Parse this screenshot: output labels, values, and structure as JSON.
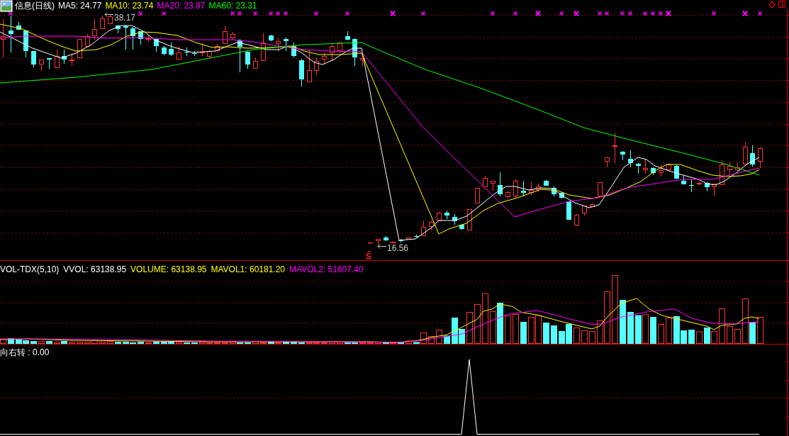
{
  "price_panel": {
    "title": "信息(日线)",
    "indicators": [
      {
        "label": "MA5: 24.77",
        "color": "#ffffff"
      },
      {
        "label": "MA10: 23.74",
        "color": "#ffff00"
      },
      {
        "label": "MA20: 23.87",
        "color": "#ff00ff"
      },
      {
        "label": "MA60: 23.31",
        "color": "#00ff00"
      }
    ],
    "high_label": "38.17",
    "low_label": "16.56",
    "signal_label": "Ŝ"
  },
  "volume_panel": {
    "title": "VOL-TDX(5,10)",
    "indicators": [
      {
        "label": "VVOL: 63138.95",
        "color": "#ffffff"
      },
      {
        "label": "VOLUME: 63138.95",
        "color": "#ffff00"
      },
      {
        "label": "MAVOL1: 60181.20",
        "color": "#ffff00"
      },
      {
        "label": "MAVOL2: 51607.40",
        "color": "#ff00ff"
      }
    ]
  },
  "indicator_panel": {
    "title": "向右转 : 0.00"
  }
}
